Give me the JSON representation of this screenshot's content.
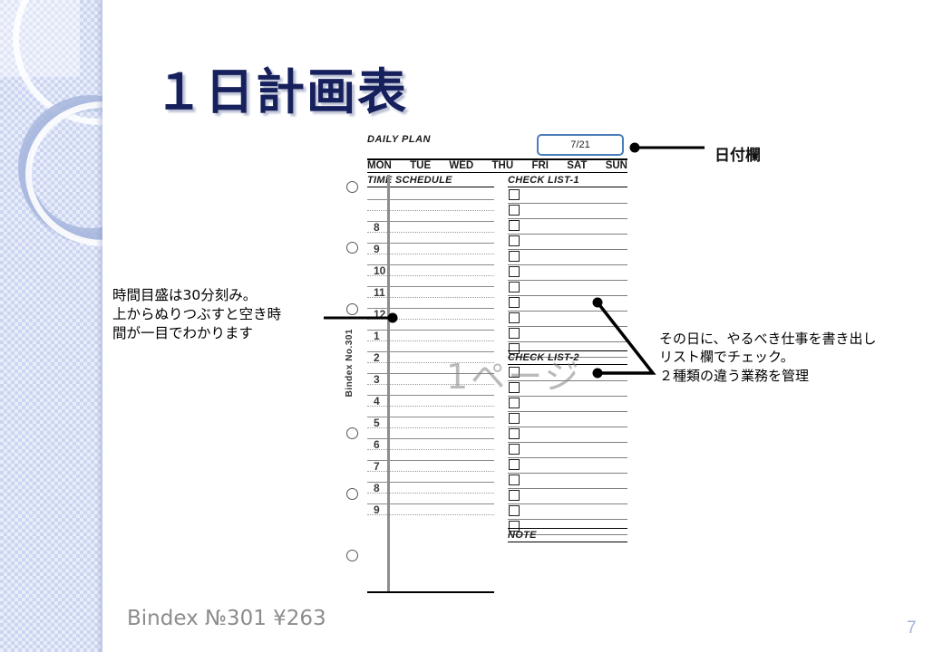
{
  "slide": {
    "title": "１日計画表",
    "page_number": "7",
    "footer_note": "Bindex №301 ¥263",
    "watermark": "1ページ"
  },
  "planner": {
    "header_label": "DAILY PLAN",
    "date_value": "7/21",
    "weekdays": [
      "MON",
      "TUE",
      "WED",
      "THU",
      "FRI",
      "SAT",
      "SUN"
    ],
    "time_schedule_header": "TIME SCHEDULE",
    "spine_text": "Bindex  No.301",
    "hours": [
      "",
      "8",
      "9",
      "10",
      "11",
      "12",
      "1",
      "2",
      "3",
      "4",
      "5",
      "6",
      "7",
      "8",
      "9"
    ],
    "check_list_1_header": "CHECK LIST-1",
    "check_list_1_rows": 11,
    "check_list_2_header": "CHECK LIST-2",
    "check_list_2_rows": 11,
    "note_header": "NOTE"
  },
  "annotations": {
    "date_field": "日付欄",
    "time_scale": "時間目盛は30分刻み。\n上からぬりつぶすと空き時\n間が一目でわかります",
    "check_list": "その日に、やるべき仕事を書き出し\nリスト欄でチェック。\n２種類の違う業務を管理"
  },
  "colors": {
    "title": "#16205c",
    "sidebar": "#ccd6f2",
    "date_box_border": "#4a7ebb",
    "page_number": "#a3b0dc",
    "footer": "#8c8c8c"
  }
}
